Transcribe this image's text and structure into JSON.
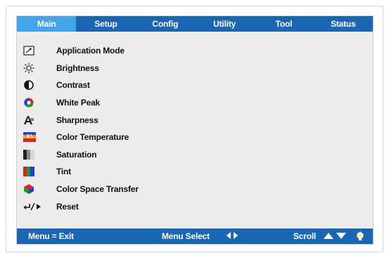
{
  "tabs": [
    {
      "label": "Main",
      "active": true
    },
    {
      "label": "Setup",
      "active": false
    },
    {
      "label": "Config",
      "active": false
    },
    {
      "label": "Utility",
      "active": false
    },
    {
      "label": "Tool",
      "active": false
    },
    {
      "label": "Status",
      "active": false
    }
  ],
  "menu": {
    "items": [
      {
        "label": "Application Mode",
        "icon": "application-mode-icon"
      },
      {
        "label": "Brightness",
        "icon": "sun-icon"
      },
      {
        "label": "Contrast",
        "icon": "contrast-icon"
      },
      {
        "label": "White Peak",
        "icon": "white-peak-icon"
      },
      {
        "label": "Sharpness",
        "icon": "sharpness-icon"
      },
      {
        "label": "Color Temperature",
        "icon": "color-temperature-icon"
      },
      {
        "label": "Saturation",
        "icon": "saturation-icon"
      },
      {
        "label": "Tint",
        "icon": "tint-icon"
      },
      {
        "label": "Color Space Transfer",
        "icon": "color-space-icon"
      },
      {
        "label": "Reset",
        "icon": "reset-icon"
      }
    ]
  },
  "footer": {
    "exit_label": "Menu = Exit",
    "select_label": "Menu Select",
    "scroll_label": "Scroll"
  },
  "colors": {
    "bar": "#1b66b3",
    "active_tab": "#42a5ea",
    "panel": "#ececec"
  }
}
